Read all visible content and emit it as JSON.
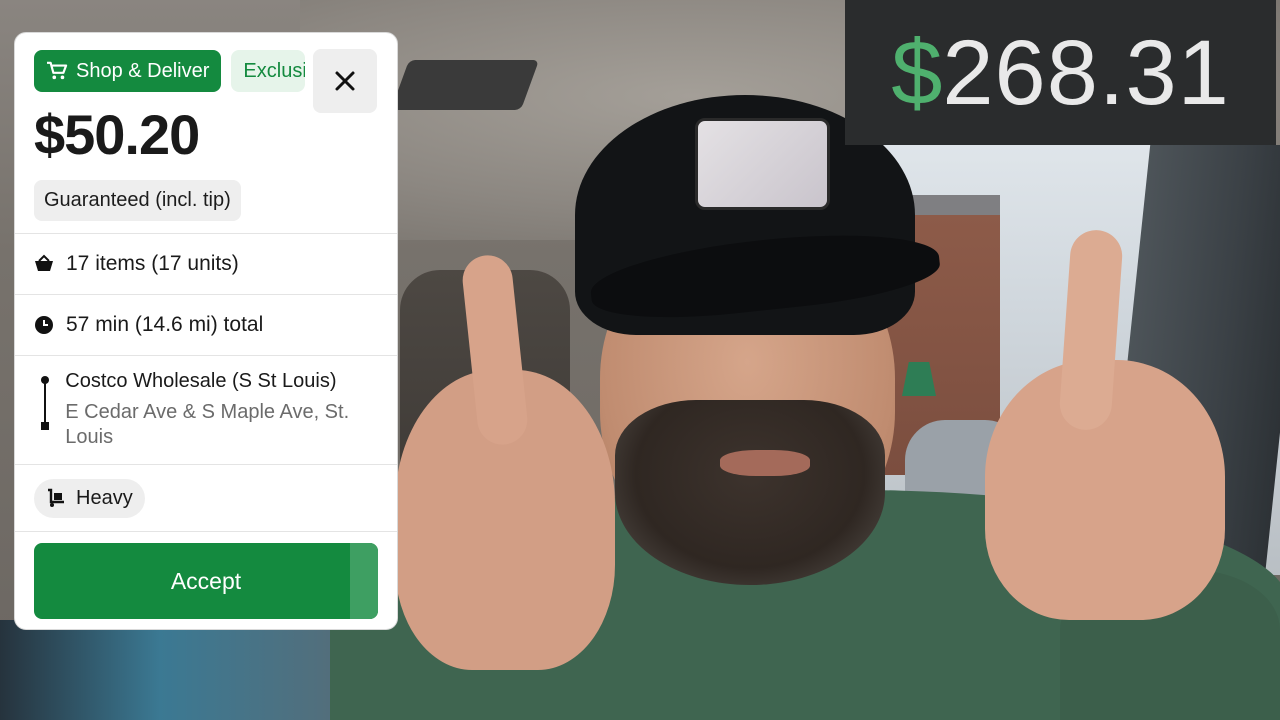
{
  "earnings_total": {
    "currency_symbol": "$",
    "amount": "268.31",
    "currency_color": "#4fb06e"
  },
  "offer_card": {
    "service_chip": {
      "label": "Shop & Deliver",
      "icon": "cart-icon"
    },
    "exclusive_chip": {
      "label": "Exclusive"
    },
    "close_icon": "close-icon",
    "price": "$50.20",
    "guarantee_label": "Guaranteed (incl. tip)",
    "items": {
      "icon": "basket-icon",
      "label": "17 items (17 units)"
    },
    "duration": {
      "icon": "clock-icon",
      "label": "57 min (14.6 mi) total"
    },
    "route": {
      "store_name": "Costco Wholesale (S St Louis)",
      "address": "E Cedar Ave & S Maple Ave, St. Louis"
    },
    "tag": {
      "icon": "dolly-icon",
      "label": "Heavy"
    },
    "accept": {
      "label": "Accept",
      "remaining_fraction": 0.08
    },
    "accent_color": "#148a3f"
  }
}
